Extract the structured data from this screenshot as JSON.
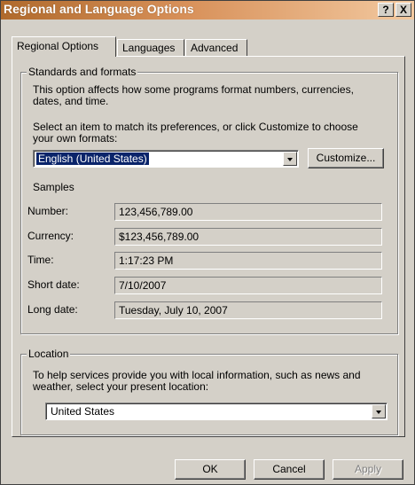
{
  "window": {
    "title": "Regional and Language Options",
    "help_label": "?",
    "close_label": "X"
  },
  "tabs": [
    {
      "label": "Regional Options",
      "active": true
    },
    {
      "label": "Languages",
      "active": false
    },
    {
      "label": "Advanced",
      "active": false
    }
  ],
  "standards": {
    "legend": "Standards and formats",
    "desc_line1": "This option affects how some programs format numbers, currencies,",
    "desc_line2": "dates, and time.",
    "select_line1": "Select an item to match its preferences, or click Customize to choose",
    "select_line2": "your own formats:",
    "format_value": "English (United States)",
    "customize_label": "Customize...",
    "samples_label": "Samples",
    "samples": [
      {
        "label": "Number:",
        "value": "123,456,789.00"
      },
      {
        "label": "Currency:",
        "value": "$123,456,789.00"
      },
      {
        "label": "Time:",
        "value": "1:17:23 PM"
      },
      {
        "label": "Short date:",
        "value": "7/10/2007"
      },
      {
        "label": "Long date:",
        "value": "Tuesday, July 10, 2007"
      }
    ]
  },
  "location": {
    "legend": "Location",
    "desc_line1": "To help services provide you with local information, such as news and",
    "desc_line2": "weather, select your present location:",
    "value": "United States"
  },
  "buttons": {
    "ok": "OK",
    "cancel": "Cancel",
    "apply": "Apply"
  },
  "colors": {
    "titlebar_start": "#b06a2c",
    "titlebar_end": "#f2c9a0",
    "face": "#d4d0c8",
    "selection": "#0a246a"
  }
}
